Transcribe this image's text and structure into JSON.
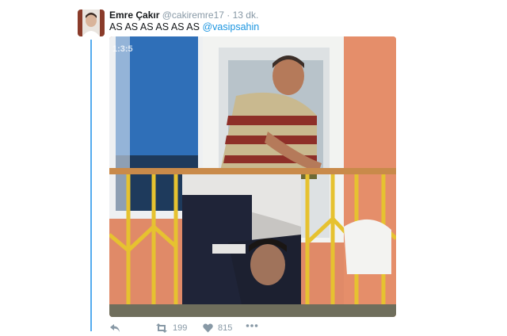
{
  "tweet": {
    "author_name": "Emre Çakır",
    "author_handle": "@cakiremre17",
    "separator": "·",
    "timestamp": "13 dk.",
    "text": "AS AS AS AS AS AS",
    "mention": "@vasipsahin",
    "media_watermark": "1:3:5"
  },
  "actions": {
    "retweet_count": "199",
    "like_count": "815"
  },
  "colors": {
    "link": "#1b95e0",
    "thread_line": "#55acee",
    "muted": "#8899a6"
  }
}
